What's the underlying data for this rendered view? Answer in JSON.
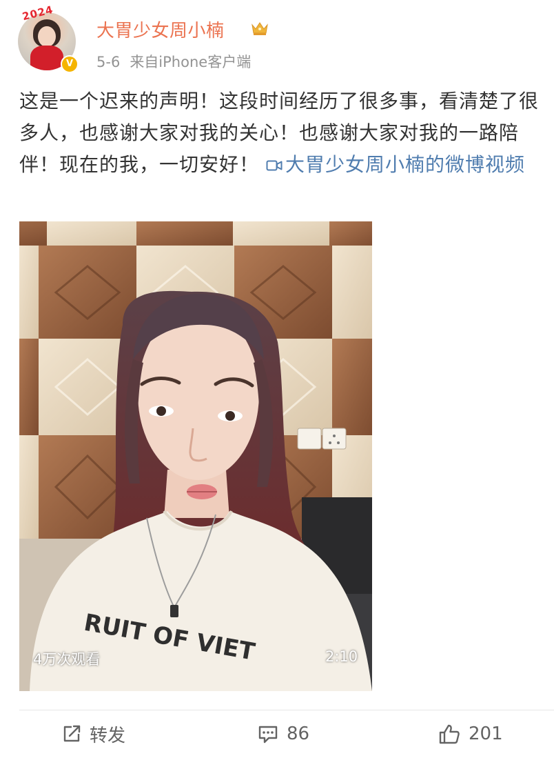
{
  "post": {
    "username": "大胃少女周小楠",
    "avatar_year_text": "2024",
    "date": "5-6",
    "source": "来自iPhone客户端",
    "text": "这是一个迟来的声明！这段时间经历了很多事，看清楚了很多人，也感谢大家对我的关心！也感谢大家对我的一路陪伴！现在的我，一切安好！",
    "video_link_label": "大胃少女周小楠的微博视频"
  },
  "video": {
    "views": "4万次观看",
    "duration": "2:10",
    "shirt_text": "RUIT OF VIET"
  },
  "actions": {
    "repost_label": "转发",
    "comment_count": "86",
    "like_count": "201"
  },
  "colors": {
    "username": "#eb7350",
    "link": "#507daf",
    "meta": "#939393",
    "body_text": "#333333",
    "crown": "#f0b53a"
  },
  "icons": [
    "crown-icon",
    "verified-icon",
    "video-camera-icon",
    "repost-icon",
    "comment-icon",
    "like-icon"
  ]
}
